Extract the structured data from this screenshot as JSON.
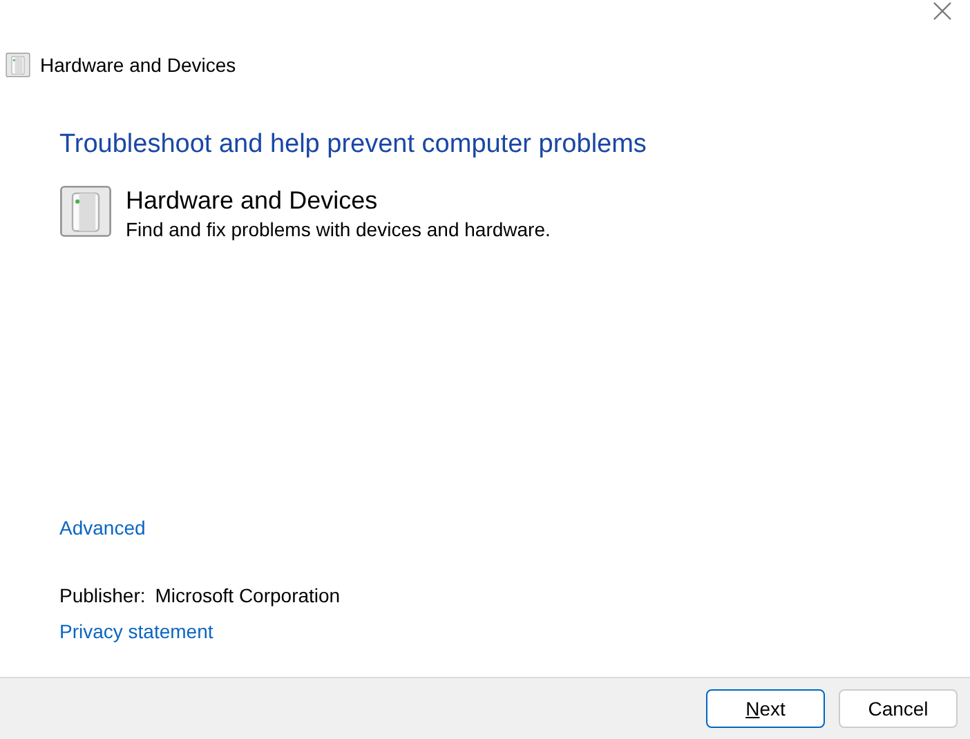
{
  "window": {
    "title": "Hardware and Devices"
  },
  "heading": "Troubleshoot and help prevent computer problems",
  "troubleshooter": {
    "name": "Hardware and Devices",
    "description": "Find and fix problems with devices and hardware."
  },
  "advanced_link": "Advanced",
  "publisher": {
    "label": "Publisher:",
    "value": "Microsoft Corporation"
  },
  "privacy_link": "Privacy statement",
  "buttons": [
    {
      "label": "Next",
      "default": true,
      "access_key_first": true
    },
    {
      "label": "Cancel",
      "default": false,
      "access_key_first": false
    }
  ]
}
